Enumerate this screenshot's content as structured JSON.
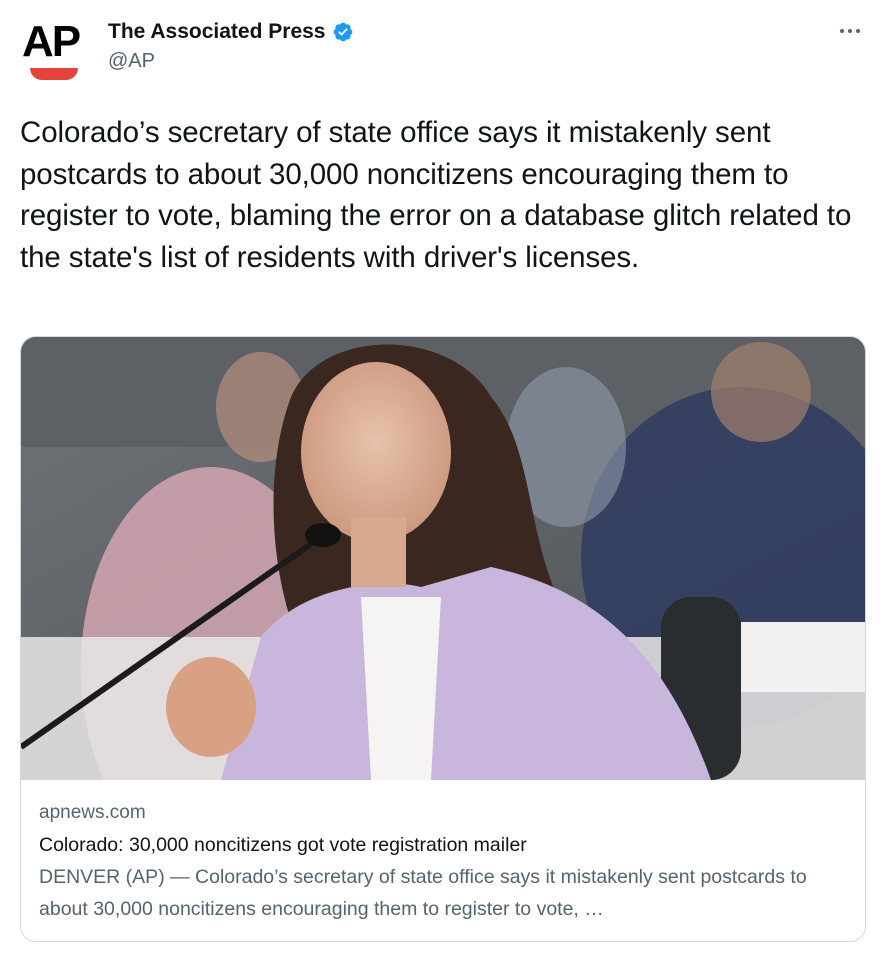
{
  "author": {
    "logo": "AP",
    "name": "The Associated Press",
    "handle": "@AP",
    "verified": true,
    "verified_color": "#1d9bf0"
  },
  "menu_icon": "more-horizontal-icon",
  "tweet": {
    "text": "Colorado’s secretary of state office says it mistakenly sent postcards to about 30,000 noncitizens encouraging them to register to vote, blaming the error on a database glitch related to the state's list of residents with driver's licenses."
  },
  "card": {
    "domain": "apnews.com",
    "title": "Colorado: 30,000 noncitizens got vote registration mailer",
    "description": "DENVER (AP) — Colorado’s secretary of state office says it mistakenly sent postcards to about 30,000 noncitizens encouraging them to register to vote, …"
  },
  "colors": {
    "text_primary": "#0f1419",
    "text_secondary": "#536471",
    "border": "#cfd9de",
    "ap_red": "#e4433c"
  }
}
